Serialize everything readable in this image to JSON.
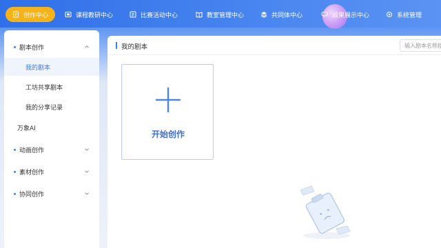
{
  "nav": {
    "items": [
      {
        "label": "创作中心",
        "icon": "document-icon",
        "active": true
      },
      {
        "label": "课程教研中心",
        "icon": "board-icon"
      },
      {
        "label": "比赛活动中心",
        "icon": "list-icon"
      },
      {
        "label": "教室管理中心",
        "icon": "book-icon"
      },
      {
        "label": "共同体中心",
        "icon": "layers-icon"
      },
      {
        "label": "成果展示中心",
        "icon": "chat-icon"
      },
      {
        "label": "系统管理",
        "icon": "gear-icon"
      }
    ],
    "accent": "#f6b21a"
  },
  "sidebar": {
    "items": [
      {
        "label": "剧本创作",
        "icon": "dot-icon",
        "expanded": true
      },
      {
        "label": "我的剧本",
        "selected": true
      },
      {
        "label": "工坊共享剧本"
      },
      {
        "label": "我的分享记录"
      },
      {
        "label": "万象AI"
      },
      {
        "label": "动画创作",
        "icon": "dot-icon"
      },
      {
        "label": "素材创作",
        "icon": "dot-icon"
      },
      {
        "label": "协同创作",
        "icon": "dot-icon"
      }
    ]
  },
  "main": {
    "title": "我的剧本",
    "search_placeholder": "输入剧本名称搜",
    "start_card_label": "开始创作"
  },
  "colors": {
    "primary": "#3e7cf0",
    "card_border": "#b8cdf5"
  }
}
